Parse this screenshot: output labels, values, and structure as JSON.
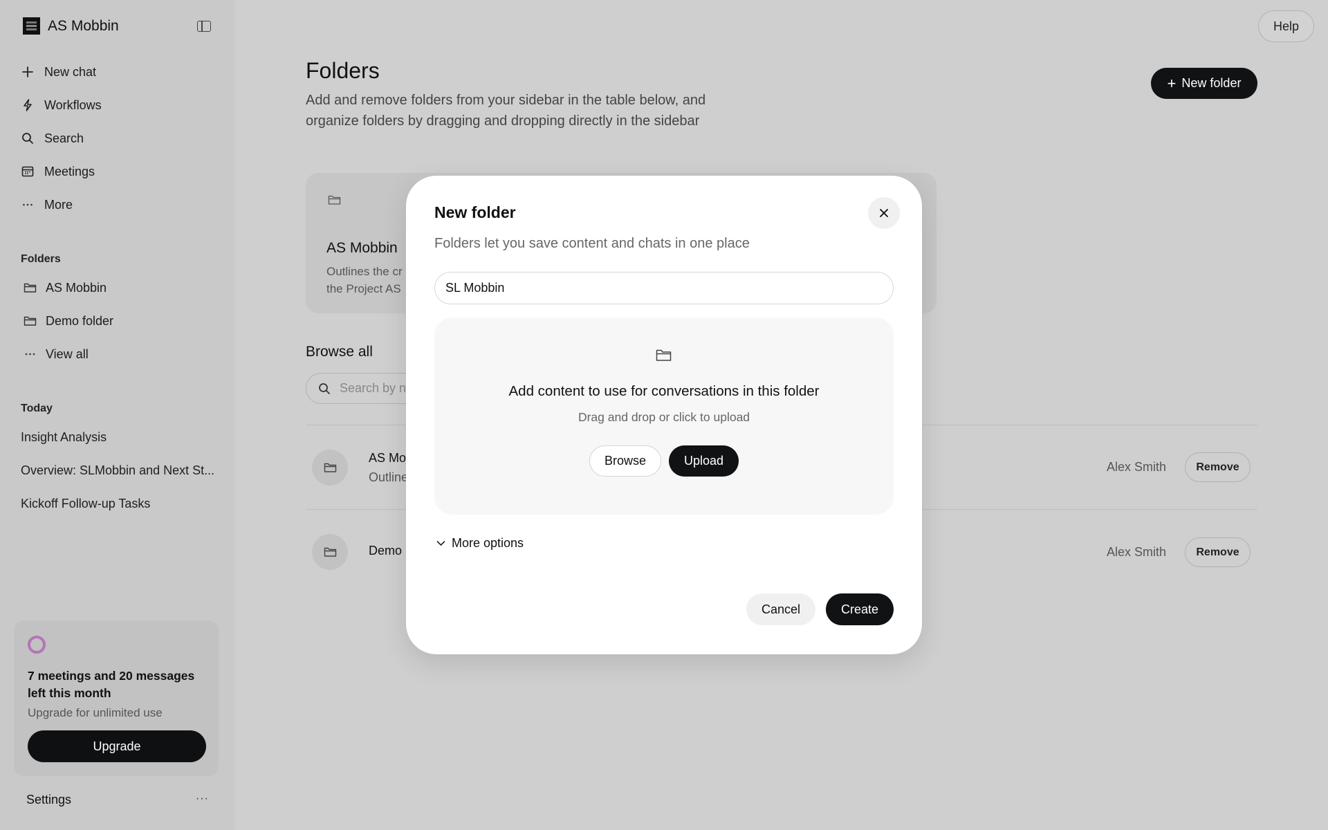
{
  "sidebar": {
    "brand_name": "AS Mobbin",
    "nav": [
      {
        "label": "New chat",
        "icon": "plus-icon"
      },
      {
        "label": "Workflows",
        "icon": "bolt-icon"
      },
      {
        "label": "Search",
        "icon": "search-icon"
      },
      {
        "label": "Meetings",
        "icon": "calendar-icon"
      },
      {
        "label": "More",
        "icon": "more-dots-icon"
      }
    ],
    "folders_label": "Folders",
    "folders": [
      {
        "label": "AS Mobbin",
        "icon": "folder-icon"
      },
      {
        "label": "Demo folder",
        "icon": "folder-icon"
      },
      {
        "label": "View all",
        "icon": "more-dots-icon"
      }
    ],
    "today_label": "Today",
    "today": [
      {
        "label": "Insight Analysis"
      },
      {
        "label": "Overview: SLMobbin and Next St..."
      },
      {
        "label": "Kickoff Follow-up Tasks"
      }
    ],
    "usage": {
      "title": "7 meetings and 20 messages left this month",
      "subtitle": "Upgrade for unlimited use",
      "button": "Upgrade"
    },
    "settings_label": "Settings",
    "settings_more": "···"
  },
  "header": {
    "help_label": "Help",
    "title": "Folders",
    "description": "Add and remove folders from your sidebar in the table below, and organize folders by dragging and dropping directly in the sidebar",
    "new_folder_label": "New folder"
  },
  "card": {
    "title": "AS Mobbin",
    "description_line1": "Outlines the cr",
    "description_line2": "the Project AS"
  },
  "browse": {
    "title": "Browse all",
    "search_placeholder": "Search by na"
  },
  "rows": [
    {
      "name": "AS Mo",
      "description": "Outline",
      "owner": "Alex Smith",
      "action": "Remove"
    },
    {
      "name": "Demo",
      "description": "",
      "owner": "Alex Smith",
      "action": "Remove"
    }
  ],
  "modal": {
    "title": "New folder",
    "subtitle": "Folders let you save content and chats in one place",
    "name_value": "SL Mobbin",
    "dropzone_title": "Add content to use for conversations in this folder",
    "dropzone_subtitle": "Drag and drop or click to upload",
    "browse_label": "Browse",
    "upload_label": "Upload",
    "more_options_label": "More options",
    "cancel_label": "Cancel",
    "create_label": "Create"
  },
  "colors": {
    "overlay_background": "#cfcfcf",
    "primary_button": "#101214",
    "usage_ring": "#b276b8"
  }
}
